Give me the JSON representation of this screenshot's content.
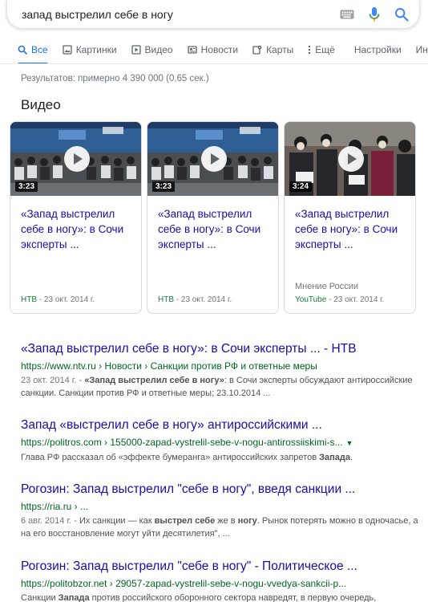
{
  "search": {
    "query": "запад выстрелил себе в ногу"
  },
  "tabs": [
    {
      "label": "Все",
      "icon": "search-icon",
      "active": true
    },
    {
      "label": "Картинки",
      "icon": "image-icon"
    },
    {
      "label": "Видео",
      "icon": "play-icon"
    },
    {
      "label": "Новости",
      "icon": "news-icon"
    },
    {
      "label": "Карты",
      "icon": "map-icon"
    },
    {
      "label": "Ещё",
      "icon": "more-vert-icon"
    },
    {
      "label": "Настройки"
    },
    {
      "label": "Инструменты"
    }
  ],
  "stats": "Результатов: примерно 4 390 000 (0,65 сек.)",
  "videos_heading": "Видео",
  "videos": [
    {
      "duration": "3:23",
      "title": "«Запад выстрелил себе в ногу»: в Сочи эксперты ...",
      "channel": "",
      "source": "НТВ",
      "date": " - 23 окт. 2014 г."
    },
    {
      "duration": "3:23",
      "title": "«Запад выстрелил себе в ногу»: в Сочи эксперты ...",
      "channel": "",
      "source": "НТВ",
      "date": " - 23 окт. 2014 г."
    },
    {
      "duration": "3:24",
      "title": "«Запад выстрелил себе в ногу»: в Сочи эксперты ...",
      "channel": "Мнение России",
      "source": "YouTube",
      "date": " - 23 окт. 2014 г."
    }
  ],
  "results": [
    {
      "title": "«Запад выстрелил себе в ногу»: в Сочи эксперты ... - НТВ",
      "url": "https://www.ntv.ru",
      "crumbs": " › Новости › Санкции против РФ и ответные меры",
      "date": "23 окт. 2014 г. - ",
      "snippet_bold": "«Запад выстрелил себе в ногу»",
      "snippet": ": в Сочи эксперты обсуждают антироссийские санкции. Санкции против РФ и ответные меры; 23.10.2014 ..."
    },
    {
      "title": "Запад «выстрелил себе в ногу» антироссийскими ...",
      "url": "https://politros.com",
      "crumbs": " › 155000-zapad-vystrelil-sebe-v-nogu-antirossiiskimi-s...",
      "snippet_a": "Глава РФ рассказал об «эффекте бумеранга» антироссийских запретов ",
      "snippet_bold": "Запада",
      "snippet_b": "."
    },
    {
      "title": "Рогозин: Запад выстрелил \"себе в ногу\", введя санкции ...",
      "url": "https://ria.ru",
      "crumbs": " › ...",
      "date": "6 авг. 2014 г. - ",
      "snippet_a": "Их санкции — как ",
      "snippet_bold1": "выстрел себе",
      "snippet_b": " же в ",
      "snippet_bold2": "ногу",
      "snippet_c": ". Рынок потерять можно в одночасье, а на его восстановление могут уйти десятилетия\", ..."
    },
    {
      "title": "Рогозин: Запад выстрелил \"себе в ногу\" - Политическое ...",
      "url": "https://politobzor.net",
      "crumbs": " › 29057-zapad-vystrelil-sebe-v-nogu-vvedya-sankcii-p...",
      "snippet_a": "Санкции ",
      "snippet_bold": "Запада",
      "snippet_b": " против российского оборонного сектора навредят, в первую очередь,"
    }
  ],
  "colors": {
    "link": "#1a0dab",
    "url_green": "#006621",
    "accent_blue": "#1a73e8"
  }
}
